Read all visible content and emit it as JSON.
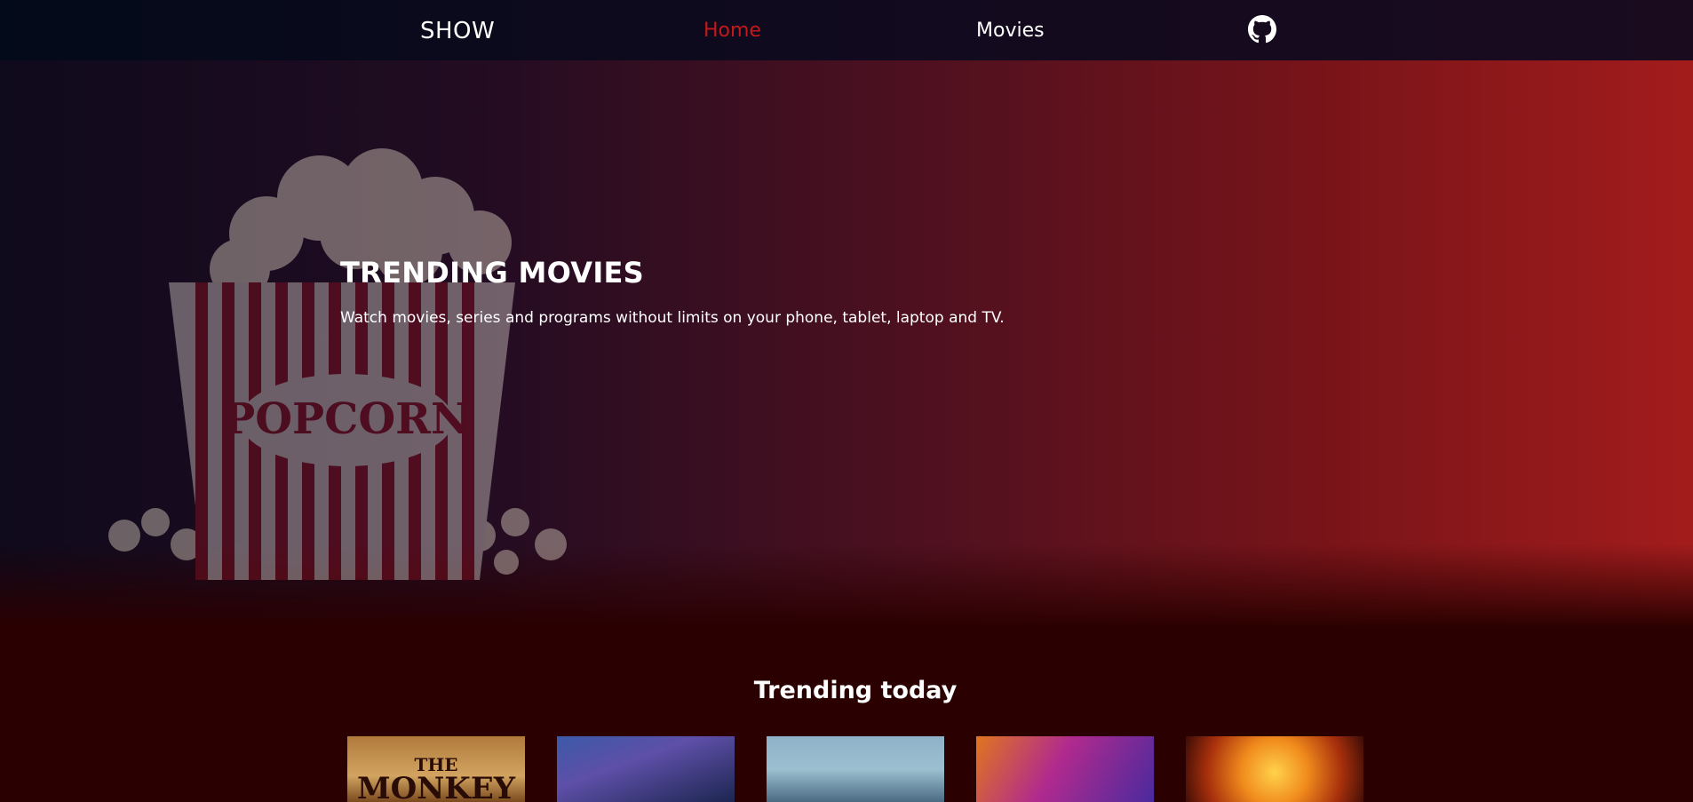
{
  "navbar": {
    "brand": "SHOW",
    "items": [
      {
        "label": "Home",
        "active": true
      },
      {
        "label": "Movies",
        "active": false
      }
    ],
    "github_icon": "github-icon",
    "active_color": "#c21a1a"
  },
  "hero": {
    "title": "TRENDING MOVIES",
    "subtitle": "Watch movies, series and programs without limits on your phone, tablet, laptop and TV.",
    "popcorn_label": "POPCORN"
  },
  "trending": {
    "title": "Trending today",
    "posters": [
      {
        "name": "poster-1",
        "text_line1": "THE",
        "text_line2": "MONKEY"
      },
      {
        "name": "poster-2"
      },
      {
        "name": "poster-3"
      },
      {
        "name": "poster-4"
      },
      {
        "name": "poster-5"
      }
    ]
  }
}
